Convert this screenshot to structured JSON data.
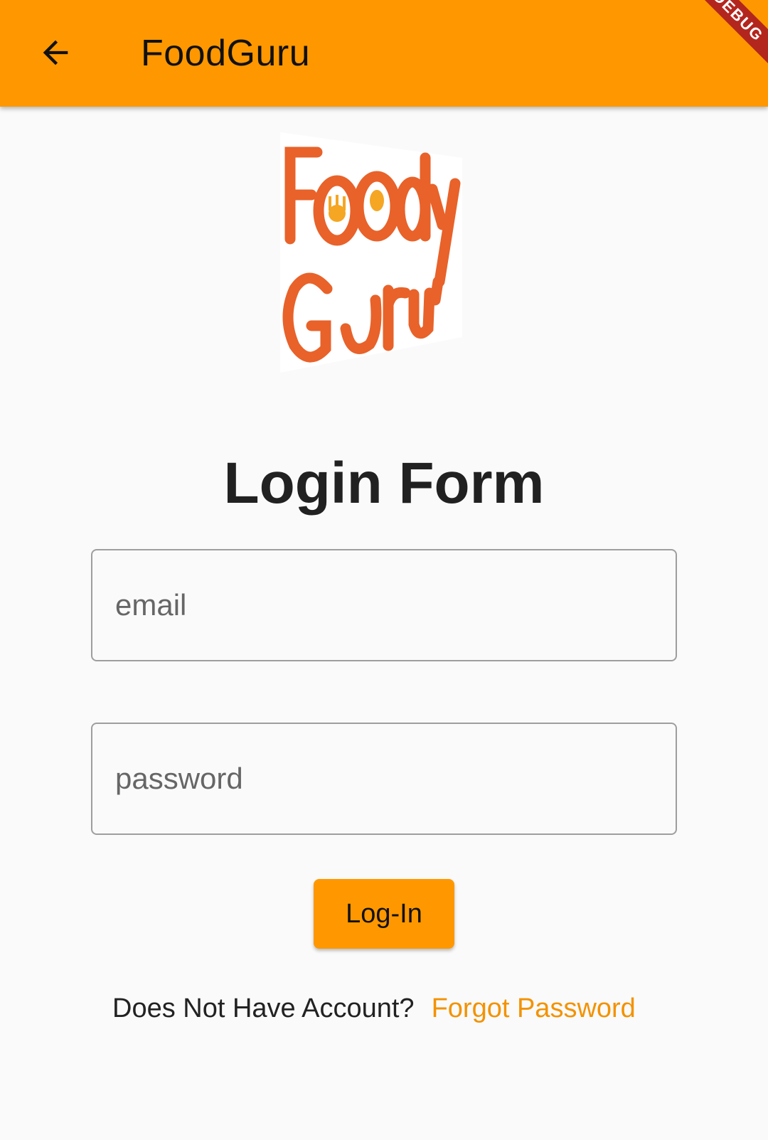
{
  "appbar": {
    "title": "FoodGuru",
    "back_icon": "arrow-back-icon",
    "banner": "DEBUG",
    "background_color": "#ff9800"
  },
  "logo": {
    "line1": "Foody",
    "line2": "Guru",
    "color": "#e8622a",
    "accent_color": "#f5a623"
  },
  "form": {
    "heading": "Login Form",
    "email_placeholder": "email",
    "password_placeholder": "password",
    "login_label": "Log-In"
  },
  "footer": {
    "prompt": "Does Not Have Account?",
    "forgot_link": "Forgot Password",
    "link_color": "#f39200"
  }
}
